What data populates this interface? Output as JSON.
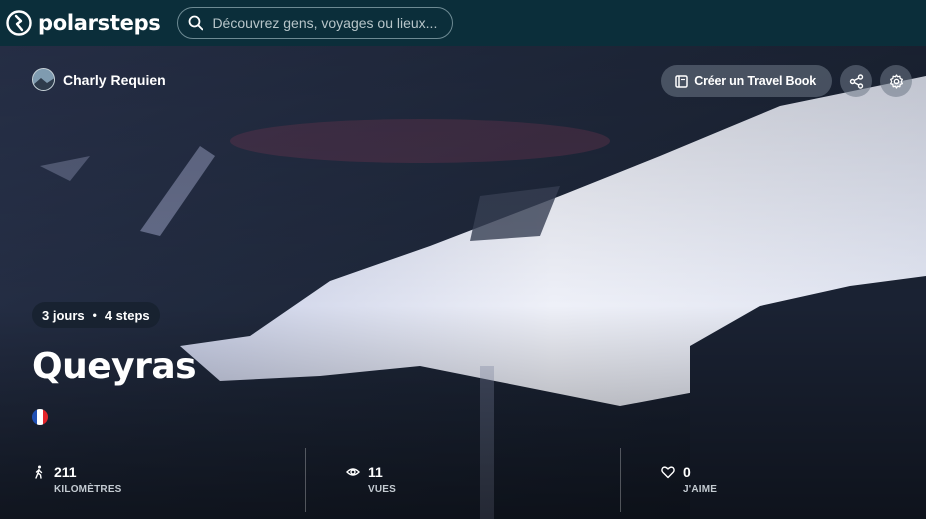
{
  "header": {
    "brand": "polarsteps",
    "search": {
      "placeholder": "Découvrez gens, voyages ou lieux..."
    }
  },
  "trip": {
    "user_name": "Charly Requien",
    "actions": {
      "travel_book_label": "Créer un Travel Book"
    },
    "days": "3 jours",
    "separator": "•",
    "steps": "4 steps",
    "title": "Queyras",
    "country_flag_colors": [
      "#1f4fb3",
      "#ffffff",
      "#e3242b"
    ]
  },
  "stats": [
    {
      "icon": "walking-person-icon",
      "value": "211",
      "label": "KILOMÈTRES"
    },
    {
      "icon": "eye-icon",
      "value": "11",
      "label": "VUES"
    },
    {
      "icon": "heart-icon",
      "value": "0",
      "label": "J'AIME"
    }
  ],
  "colors": {
    "topbar": "#0b2e3a",
    "button_bg": "#6e7887"
  }
}
